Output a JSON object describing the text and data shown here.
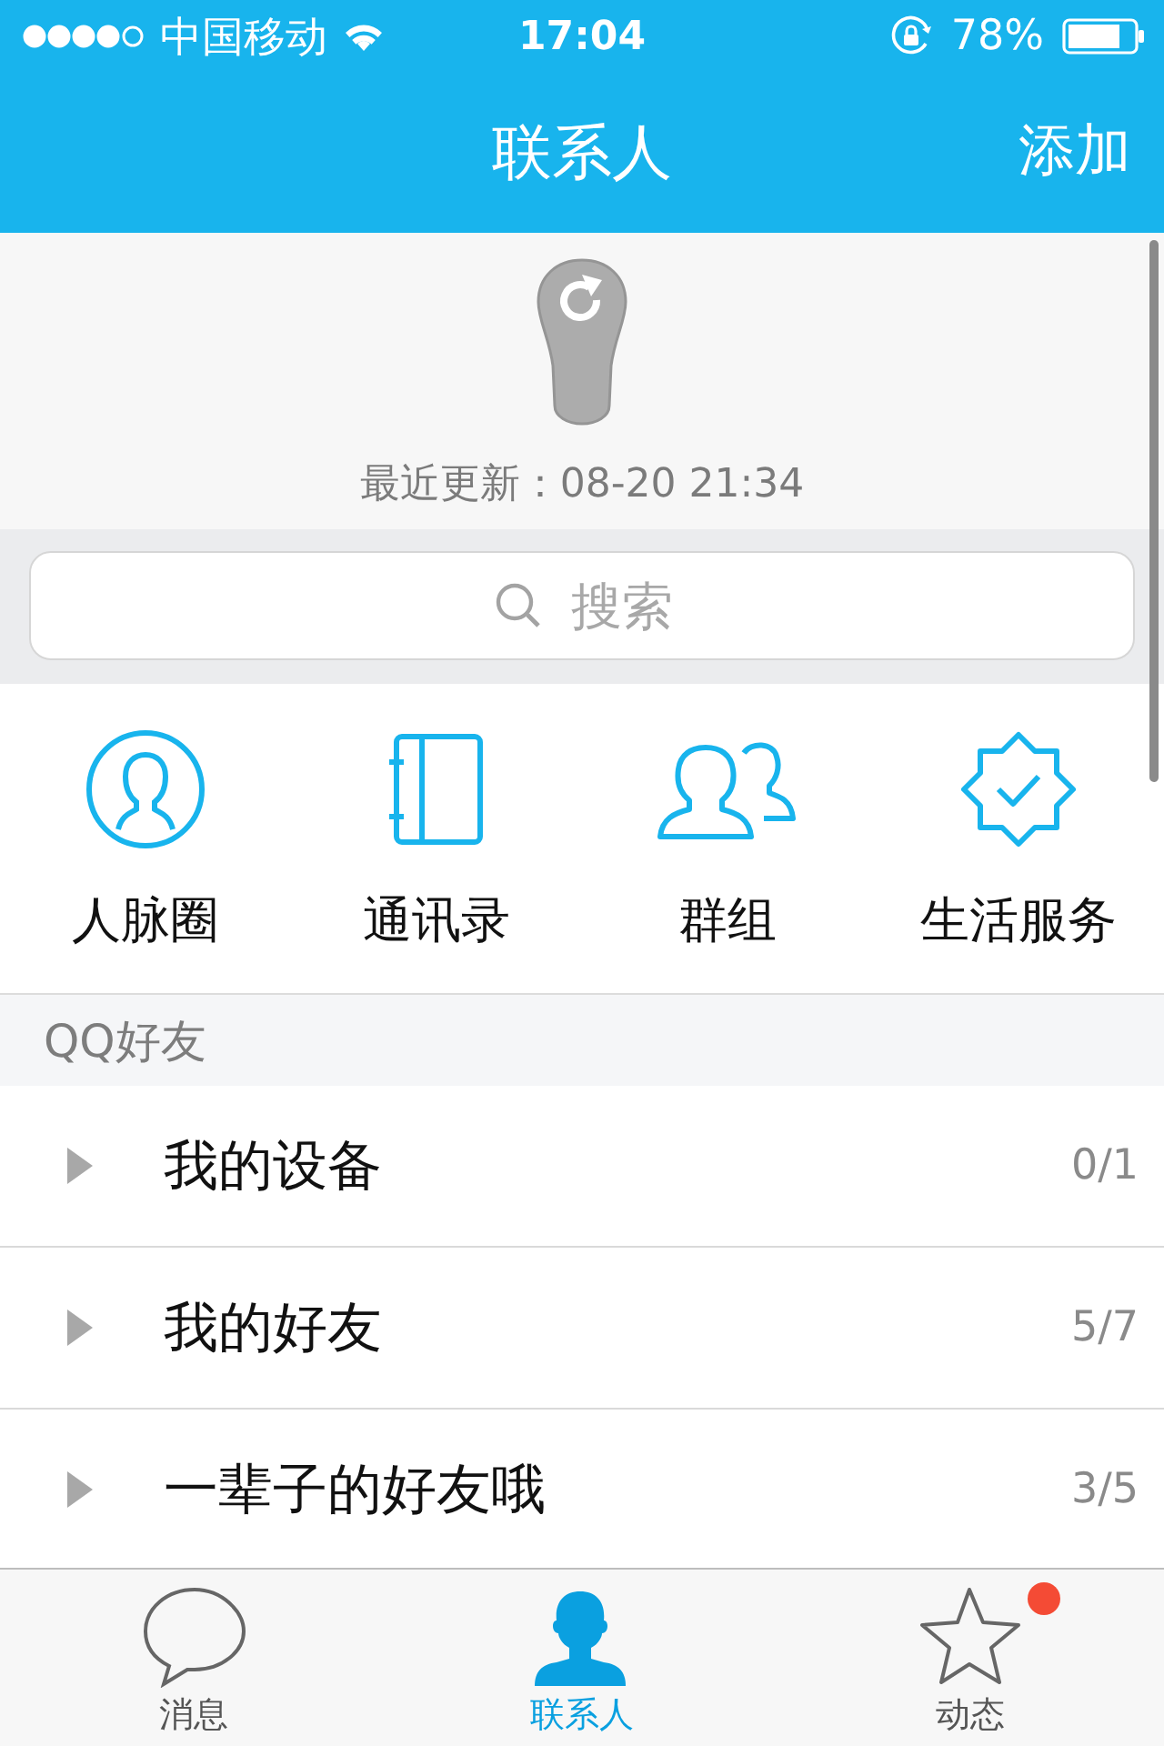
{
  "status_bar": {
    "carrier": "中国移动",
    "time": "17:04",
    "battery": "78%"
  },
  "nav": {
    "title": "联系人",
    "action": "添加"
  },
  "refresh": {
    "label": "最近更新：08-20 21:34"
  },
  "search": {
    "placeholder": "搜索"
  },
  "shortcuts": [
    {
      "kind": "circle-person",
      "label": "人脉圈"
    },
    {
      "kind": "book",
      "label": "通讯录"
    },
    {
      "kind": "people",
      "label": "群组"
    },
    {
      "kind": "badge",
      "label": "生活服务"
    }
  ],
  "section": {
    "title": "QQ好友"
  },
  "groups": [
    {
      "name": "我的设备",
      "count": "0/1",
      "expanded": false
    },
    {
      "name": "我的好友",
      "count": "5/7",
      "expanded": false
    },
    {
      "name": "一辈子的好友哦",
      "count": "3/5",
      "expanded": false
    }
  ],
  "tabs": [
    {
      "kind": "chat",
      "label": "消息",
      "selected": false,
      "badge": false
    },
    {
      "kind": "person",
      "label": "联系人",
      "selected": true,
      "badge": false
    },
    {
      "kind": "star",
      "label": "动态",
      "selected": false,
      "badge": true
    }
  ]
}
